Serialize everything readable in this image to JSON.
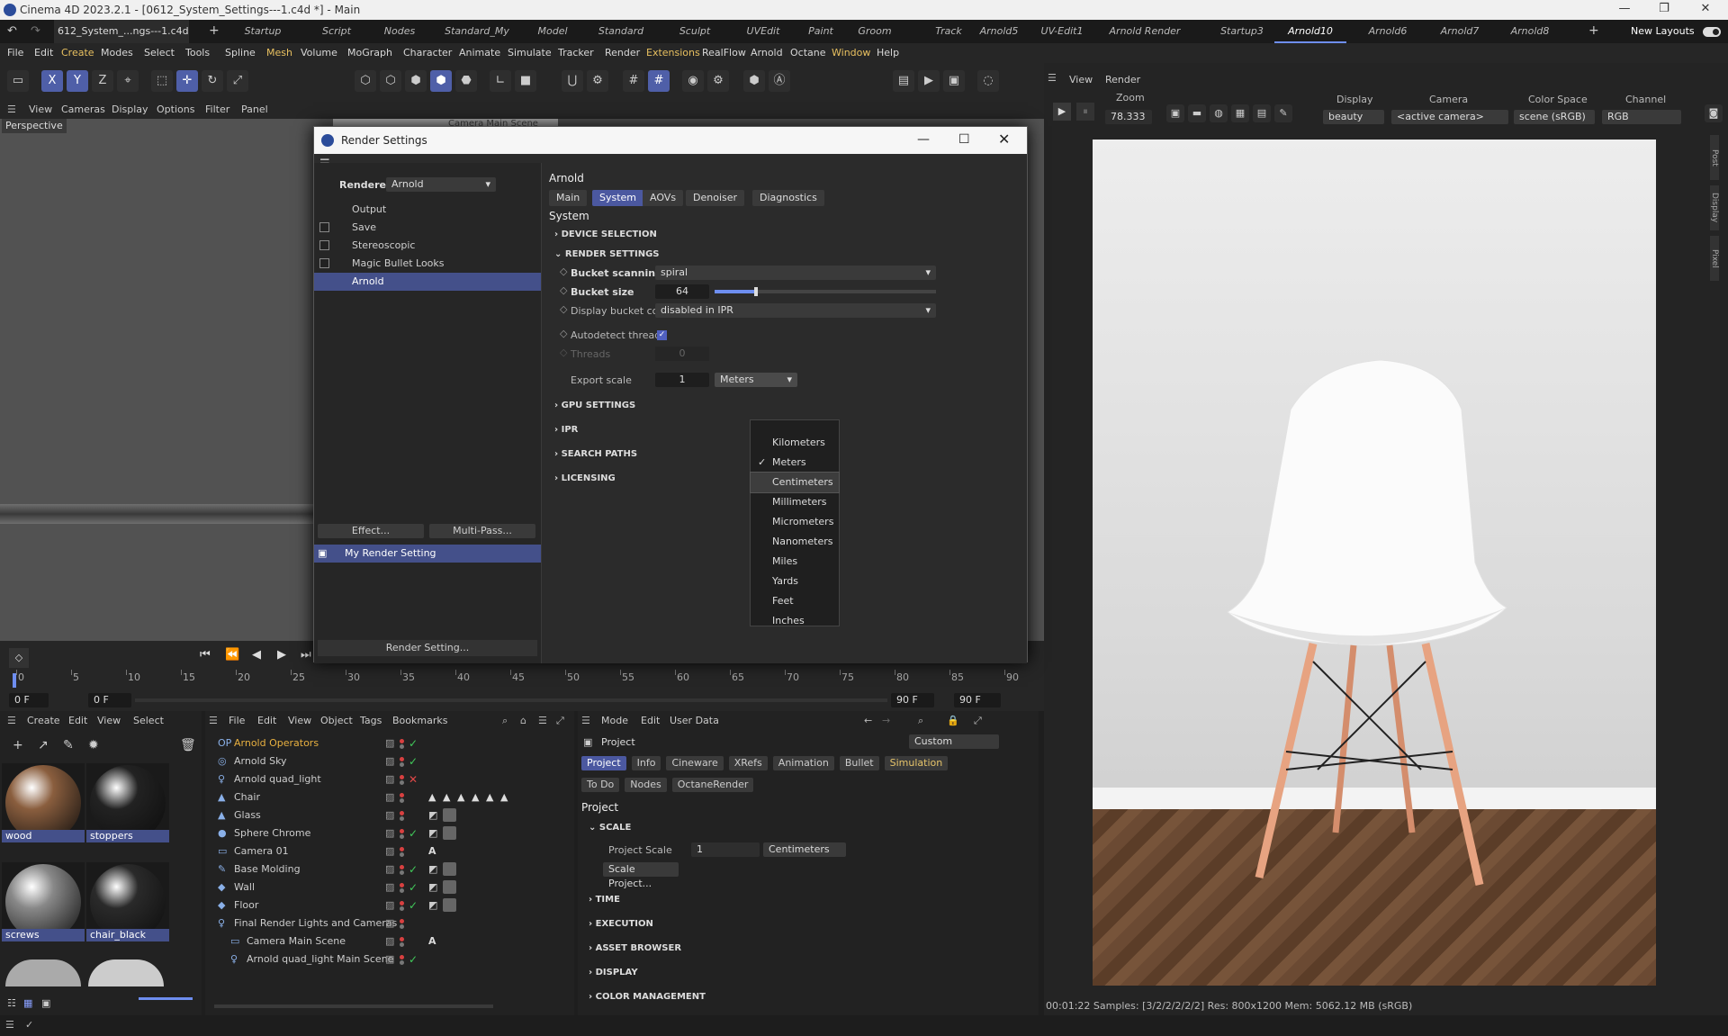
{
  "window": {
    "title": "Cinema 4D 2023.2.1 - [0612_System_Settings---1.c4d *] - Main",
    "min": "—",
    "max": "❐",
    "close": "✕"
  },
  "doc_tab": {
    "name": "612_System_...ngs---1.c4d *",
    "close": "✕",
    "add": "+"
  },
  "layout_tabs": [
    "Startup",
    "Script",
    "Nodes",
    "Standard_My",
    "Model",
    "Standard",
    "Sculpt",
    "UVEdit",
    "Paint",
    "Groom",
    "Track",
    "Arnold5",
    "UV-Edit1",
    "Arnold Render",
    "Startup3",
    "Arnold10",
    "Arnold6",
    "Arnold7",
    "Arnold8"
  ],
  "layout_active": "Arnold10",
  "new_layouts": "New Layouts",
  "menu": [
    "File",
    "Edit",
    "Create",
    "Modes",
    "Select",
    "Tools",
    "Spline",
    "Mesh",
    "Volume",
    "MoGraph",
    "Character",
    "Animate",
    "Simulate",
    "Tracker",
    "Render",
    "Extensions",
    "RealFlow",
    "Arnold",
    "Octane",
    "Window",
    "Help"
  ],
  "viewport_menu": [
    "View",
    "Cameras",
    "Display",
    "Options",
    "Filter",
    "Panel"
  ],
  "viewport_label": "Perspective",
  "camera_tab": "Camera Main Scene",
  "render_view": {
    "menu": [
      "View",
      "Render"
    ],
    "zoom_label": "Zoom",
    "zoom": "78.333",
    "display_label": "Display",
    "display": "beauty",
    "camera_label": "Camera",
    "camera": "<active camera>",
    "colorspace_label": "Color Space",
    "colorspace": "scene (sRGB)",
    "channel_label": "Channel",
    "channel": "RGB",
    "side_tabs": [
      "Post",
      "Display",
      "Pixel"
    ],
    "status": "00:01:22  Samples: [3/2/2/2/2/2]  Res: 800x1200  Mem: 5062.12 MB  (sRGB)"
  },
  "dialog": {
    "title": "Render Settings",
    "renderer_label": "Renderer",
    "renderer": "Arnold",
    "left_items": [
      {
        "label": "Output",
        "check": null
      },
      {
        "label": "Save",
        "check": false
      },
      {
        "label": "Stereoscopic",
        "check": false
      },
      {
        "label": "Magic Bullet Looks",
        "check": false
      },
      {
        "label": "Arnold",
        "check": null,
        "selected": true
      }
    ],
    "effect_btn": "Effect...",
    "multipass_btn": "Multi-Pass...",
    "setting_name": "My Render Setting",
    "render_setting_btn": "Render Setting...",
    "heading": "Arnold",
    "tabs": [
      "Main",
      "System",
      "AOVs",
      "Denoiser",
      "Diagnostics"
    ],
    "tab_active": "System",
    "section": "System",
    "groups": {
      "device": "DEVICE SELECTION",
      "render": "RENDER SETTINGS",
      "gpu": "GPU SETTINGS",
      "ipr": "IPR",
      "search": "SEARCH PATHS",
      "licensing": "LICENSING"
    },
    "bucket_scanning_label": "Bucket scanning*",
    "bucket_scanning": "spiral",
    "bucket_size_label": "Bucket size",
    "bucket_size": "64",
    "bucket_size_slider": 0.18,
    "bucket_corners_label": "Display bucket corners",
    "bucket_corners": "disabled in IPR",
    "autodetect_label": "Autodetect threads",
    "threads_label": "Threads",
    "threads": "0",
    "export_scale_label": "Export scale",
    "export_scale": "1",
    "export_unit": "Meters",
    "units": [
      "Kilometers",
      "Meters",
      "Centimeters",
      "Millimeters",
      "Micrometers",
      "Nanometers",
      "Miles",
      "Yards",
      "Feet",
      "Inches"
    ],
    "unit_checked": "Meters",
    "unit_hover": "Centimeters"
  },
  "timeline": {
    "ticks": [
      "0",
      "5",
      "10",
      "15",
      "20",
      "25",
      "30",
      "35",
      "40",
      "45",
      "50",
      "55",
      "60",
      "65",
      "70",
      "75",
      "80",
      "85",
      "90"
    ],
    "start": "0 F",
    "start2": "0 F",
    "end": "90 F",
    "end2": "90 F"
  },
  "materials": {
    "menu": [
      "Create",
      "Edit",
      "View",
      "Select"
    ],
    "items": [
      {
        "name": "wood",
        "color": "#8a5e3e"
      },
      {
        "name": "stoppers",
        "color": "#222"
      },
      {
        "name": "screws",
        "color": "#888"
      },
      {
        "name": "chair_black",
        "color": "#2a2a2a"
      }
    ]
  },
  "objects": {
    "menu": [
      "File",
      "Edit",
      "View",
      "Object",
      "Tags",
      "Bookmarks"
    ],
    "items": [
      {
        "name": "Arnold Operators",
        "icon": "OP",
        "indent": 0,
        "status": "check",
        "color": "#e8b040"
      },
      {
        "name": "Arnold Sky",
        "icon": "◎",
        "indent": 0,
        "status": "check"
      },
      {
        "name": "Arnold quad_light",
        "icon": "♀",
        "indent": 0,
        "status": "x"
      },
      {
        "name": "Chair",
        "icon": "▲",
        "indent": 0,
        "status": ""
      },
      {
        "name": "Glass",
        "icon": "▲",
        "indent": 0,
        "status": ""
      },
      {
        "name": "Sphere Chrome",
        "icon": "●",
        "indent": 0,
        "status": "check"
      },
      {
        "name": "Camera 01",
        "icon": "▭",
        "indent": 0,
        "status": ""
      },
      {
        "name": "Base Molding",
        "icon": "✎",
        "indent": 0,
        "status": "check"
      },
      {
        "name": "Wall",
        "icon": "◆",
        "indent": 0,
        "status": "check"
      },
      {
        "name": "Floor",
        "icon": "◆",
        "indent": 0,
        "status": "check"
      },
      {
        "name": "Final Render Lights and Cameras",
        "icon": "♀",
        "indent": 0,
        "status": ""
      },
      {
        "name": "Camera Main Scene",
        "icon": "▭",
        "indent": 1,
        "status": ""
      },
      {
        "name": "Arnold quad_light Main Scene",
        "icon": "♀",
        "indent": 1,
        "status": "check"
      }
    ]
  },
  "attributes": {
    "menu": [
      "Mode",
      "Edit",
      "User Data"
    ],
    "object": "Project",
    "preset": "Custom",
    "tabs": [
      {
        "label": "Project",
        "on": true
      },
      {
        "label": "Info"
      },
      {
        "label": "Cineware"
      },
      {
        "label": "XRefs"
      },
      {
        "label": "Animation"
      },
      {
        "label": "Bullet"
      },
      {
        "label": "Simulation",
        "y": true
      }
    ],
    "tabs2": [
      "To Do",
      "Nodes",
      "OctaneRender"
    ],
    "heading": "Project",
    "scale_group": "SCALE",
    "project_scale_label": "Project Scale",
    "project_scale": "1",
    "project_unit": "Centimeters",
    "scale_btn": "Scale Project...",
    "groups": [
      "TIME",
      "EXECUTION",
      "ASSET BROWSER",
      "DISPLAY",
      "COLOR MANAGEMENT"
    ]
  }
}
